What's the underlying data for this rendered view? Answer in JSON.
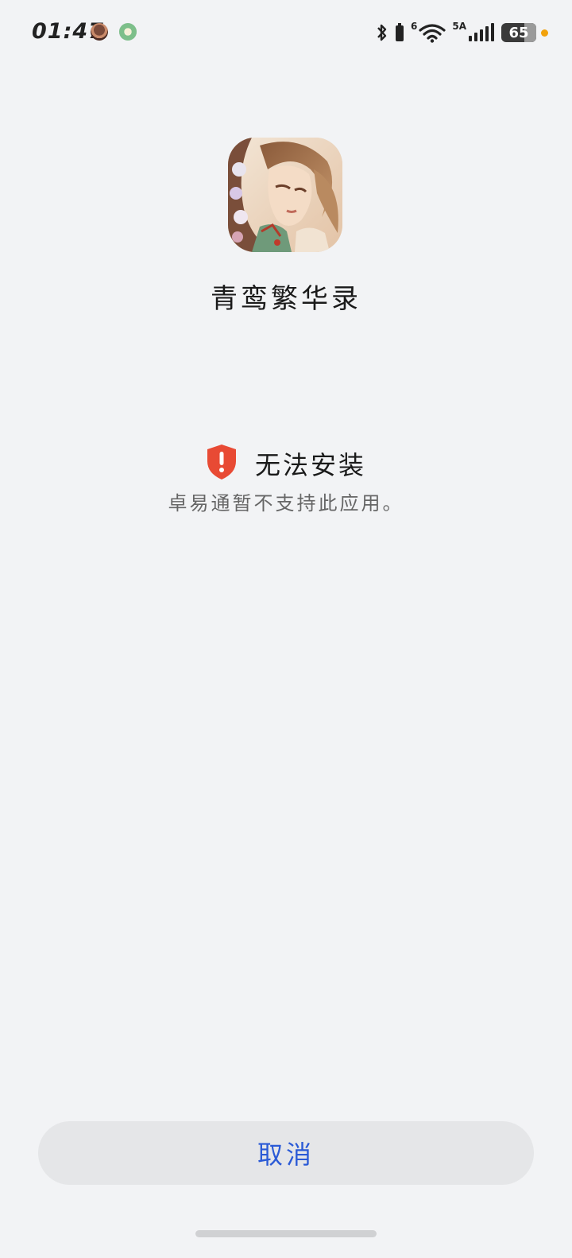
{
  "status_bar": {
    "time": "01:47",
    "net_wifi_tag": "6",
    "net_cell_tag": "5A",
    "battery": "65",
    "icons": [
      "food-notification-icon",
      "app-notification-icon",
      "bluetooth-icon",
      "battery-saver-icon",
      "wifi-icon",
      "signal-icon"
    ]
  },
  "app": {
    "name": "青鸾繁华录",
    "icon": "app-icon-portrait"
  },
  "error": {
    "icon": "shield-alert-icon",
    "title": "无法安装",
    "description": "卓易通暂不支持此应用。"
  },
  "actions": {
    "cancel_label": "取消"
  },
  "colors": {
    "background": "#f2f3f5",
    "accent": "#2a5ad6",
    "error": "#e84a34",
    "button_bg": "#e5e6e8"
  }
}
